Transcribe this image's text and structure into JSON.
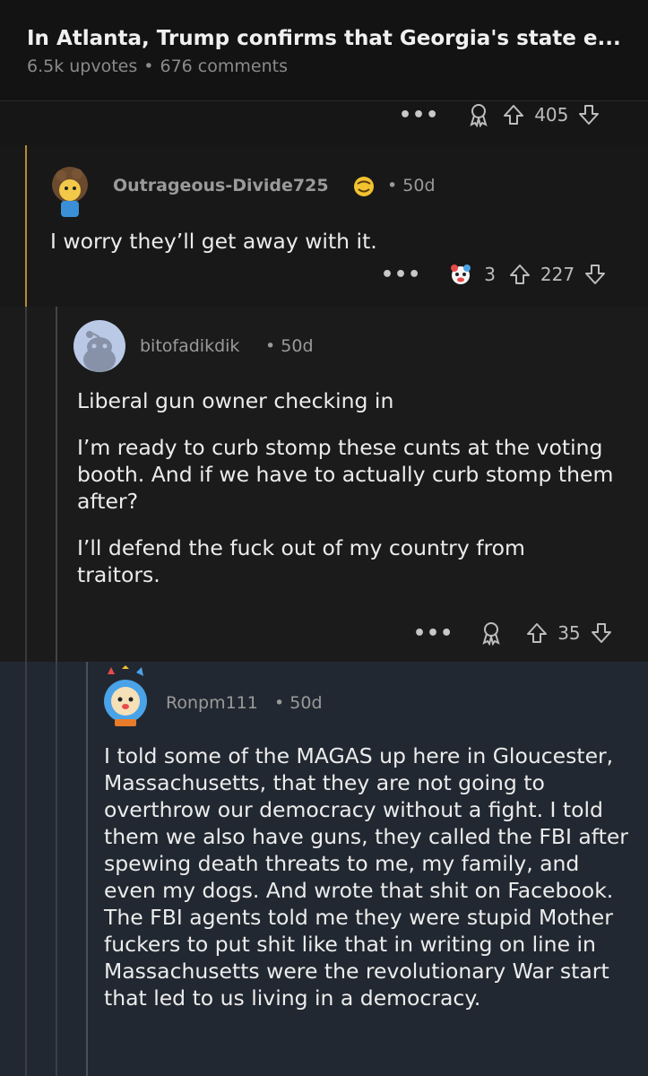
{
  "post": {
    "title": "In Atlanta, Trump confirms that Georgia's state e...",
    "upvotes": "6.5k upvotes",
    "separator": "•",
    "comments": "676 comments"
  },
  "parent_actions": {
    "more": "•••",
    "score": "405"
  },
  "comment1": {
    "username": "Outrageous-Divide725",
    "separator": "•",
    "age": "50d",
    "body": "I worry they’ll get away with it.",
    "more": "•••",
    "award_count": "3",
    "score": "227"
  },
  "comment2": {
    "username": "bitofadikdik",
    "separator": "•",
    "age": "50d",
    "paragraphs": [
      "Liberal gun owner checking in",
      "I’m ready to curb stomp these cunts at the voting booth. And if we have to actually curb stomp them after?",
      "I’ll defend the fuck out of my country from traitors."
    ],
    "more": "•••",
    "score": "35"
  },
  "comment3": {
    "username": "Ronpm111",
    "separator": "•",
    "age": "50d",
    "body": "I told some of the MAGAS up here in Gloucester, Massachusetts, that they are not going to overthrow our democracy without a fight. I told them we also have guns, they called the FBI after spewing death threats to me, my family, and even my dogs. And wrote that shit on Facebook. The FBI agents told me they were stupid Mother fuckers to put shit like that in writing on line in Massachusetts were the revolutionary War start that led to us living in a democracy."
  },
  "colors": {
    "thread_gold": "#b8892f",
    "thread_gray": "#444444",
    "highlight_bg": "#222831"
  }
}
